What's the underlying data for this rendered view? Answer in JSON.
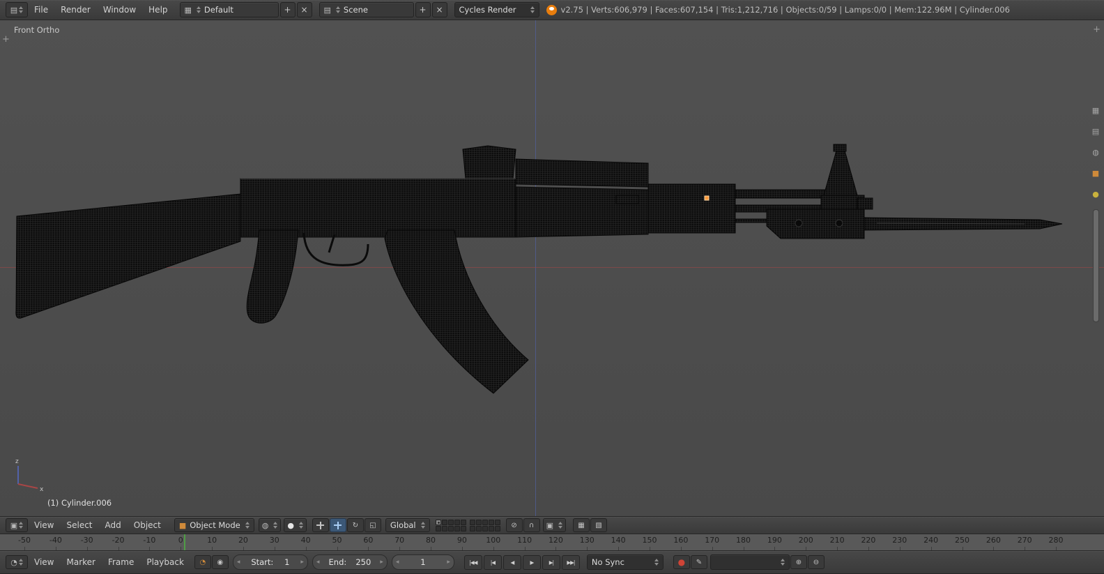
{
  "header": {
    "menus": [
      "File",
      "Render",
      "Window",
      "Help"
    ],
    "layout_selector": {
      "value": "Default"
    },
    "scene_selector": {
      "value": "Scene"
    },
    "engine_selector": {
      "value": "Cycles Render"
    },
    "stats": "v2.75 | Verts:606,979 | Faces:607,154 | Tris:1,212,716 | Objects:0/59 | Lamps:0/0 | Mem:122.96M | Cylinder.006"
  },
  "viewport": {
    "view_label": "Front Ortho",
    "active_object_label": "(1) Cylinder.006",
    "axis_gizmo": {
      "x_label": "x",
      "z_label": "z"
    }
  },
  "viewport_header": {
    "menus": [
      "View",
      "Select",
      "Add",
      "Object"
    ],
    "mode_selector": {
      "value": "Object Mode"
    },
    "orientation_selector": {
      "value": "Global"
    },
    "layers": {
      "groups": 2,
      "per_group": 10,
      "active_index": 0
    }
  },
  "timeline": {
    "menus": [
      "View",
      "Marker",
      "Frame",
      "Playback"
    ],
    "start_field": {
      "label": "Start:",
      "value": "1"
    },
    "end_field": {
      "label": "End:",
      "value": "250"
    },
    "current_frame": "1",
    "sync_selector": {
      "value": "No Sync"
    },
    "ruler_labels": [
      "-50",
      "-40",
      "-30",
      "-20",
      "-10",
      "0",
      "10",
      "20",
      "30",
      "40",
      "50",
      "60",
      "70",
      "80",
      "90",
      "100",
      "110",
      "120",
      "130",
      "140",
      "150",
      "160",
      "170",
      "180",
      "190",
      "200",
      "210",
      "220",
      "230",
      "240",
      "250",
      "260",
      "270",
      "280"
    ]
  },
  "icons": {
    "plus": "+",
    "close": "×",
    "info_editor": "▤",
    "view3d_editor": "▣",
    "timeline_editor": "◔",
    "screen_browse": "▦",
    "scene_browse": "▤",
    "mode_cube": "■",
    "shading_globe": "◍",
    "pivot_sphere": "●",
    "rotate": "↻",
    "scale": "◱",
    "scene_lock": "⊘",
    "magnet": "∩",
    "snap_element": "▣",
    "render_still": "▦",
    "render_anim": "▧",
    "preview_range": "◔",
    "lock": "◉",
    "jump_start": "|◀◀",
    "prev_key": "|◀",
    "play_rev": "◀",
    "play": "▶",
    "next_key": "▶|",
    "jump_end": "▶▶|",
    "record": "●",
    "pen": "✎",
    "key_insert": "⊕",
    "key_delete": "⊖",
    "field_left": "◂",
    "field_right": "▸",
    "prop_tab_render": "▦",
    "prop_tab_scene": "▤",
    "prop_tab_world": "◍",
    "prop_tab_object": "■",
    "prop_tab_modifier": "◆",
    "prop_tab_material": "●",
    "expand": "+"
  },
  "colors": {
    "accent_blue": "#5680c2",
    "axis_x_red": "#9e4646",
    "axis_z_blue": "#5262a8",
    "current_frame_green": "#4f9c45",
    "record_red": "#cf4436",
    "object_origin_orange": "#ff9a3c",
    "blender_orange": "#e87d0d"
  }
}
